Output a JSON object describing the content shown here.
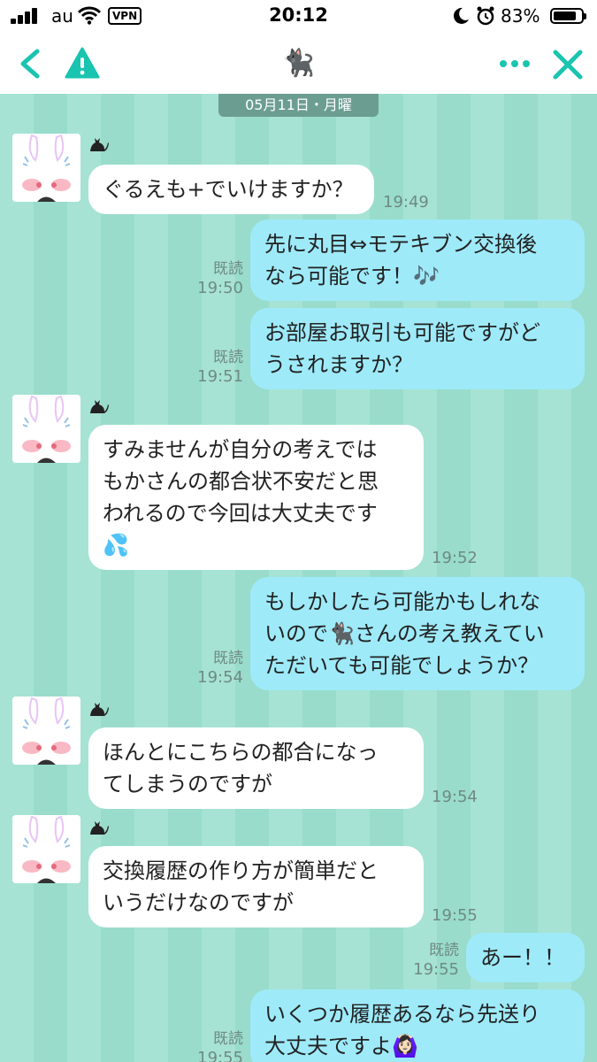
{
  "status_bar": {
    "carrier": "au",
    "vpn": "VPN",
    "time": "20:12",
    "battery_percent": "83%",
    "battery_level": 0.83,
    "icons": [
      "signal-icon",
      "wifi-icon",
      "moon-icon",
      "alarm-icon",
      "battery-icon"
    ]
  },
  "nav": {
    "title": "🐈‍⬛",
    "icons": [
      "back-icon",
      "warning-icon",
      "more-icon",
      "close-icon"
    ],
    "accent_color": "#19c4b0"
  },
  "chat": {
    "date_label": "05月11日・月曜",
    "read_label": "既読",
    "messages": [
      {
        "dir": "in",
        "text": "ぐるえも+でいけますか？",
        "time": "19:49"
      },
      {
        "dir": "out",
        "text": "先に丸目⇔モテキブン交換後\nなら可能です！🎶",
        "time": "19:50",
        "read": true
      },
      {
        "dir": "out",
        "text": "お部屋お取引も可能ですがど\nうされますか？",
        "time": "19:51",
        "read": true
      },
      {
        "dir": "in",
        "text": "すみませんが自分の考えでは\nもかさんの都合状不安だと思\nわれるので今回は大丈夫です\n💦",
        "time": "19:52"
      },
      {
        "dir": "out",
        "text": "もしかしたら可能かもしれな\nいので🐈‍⬛さんの考え教えてい\nただいても可能でしょうか？",
        "time": "19:54",
        "read": true
      },
      {
        "dir": "in",
        "text": "ほんとにこちらの都合になっ\nてしまうのですが",
        "time": "19:54"
      },
      {
        "dir": "in",
        "text": "交換履歴の作り方が簡単だと\nいうだけなのですが",
        "time": "19:55"
      },
      {
        "dir": "out",
        "text": "あー！！",
        "time": "19:55",
        "read": true
      },
      {
        "dir": "out",
        "text": "いくつか履歴あるなら先送り\n大丈夫ですよ🙆🏻‍♀️",
        "time": "19:55",
        "read": true
      }
    ],
    "colors": {
      "stripe_a": "#a6e3d4",
      "stripe_b": "#99dccb",
      "bubble_in": "#ffffff",
      "bubble_out": "#9eeaf9",
      "date_pill": "#6b9e90"
    }
  }
}
